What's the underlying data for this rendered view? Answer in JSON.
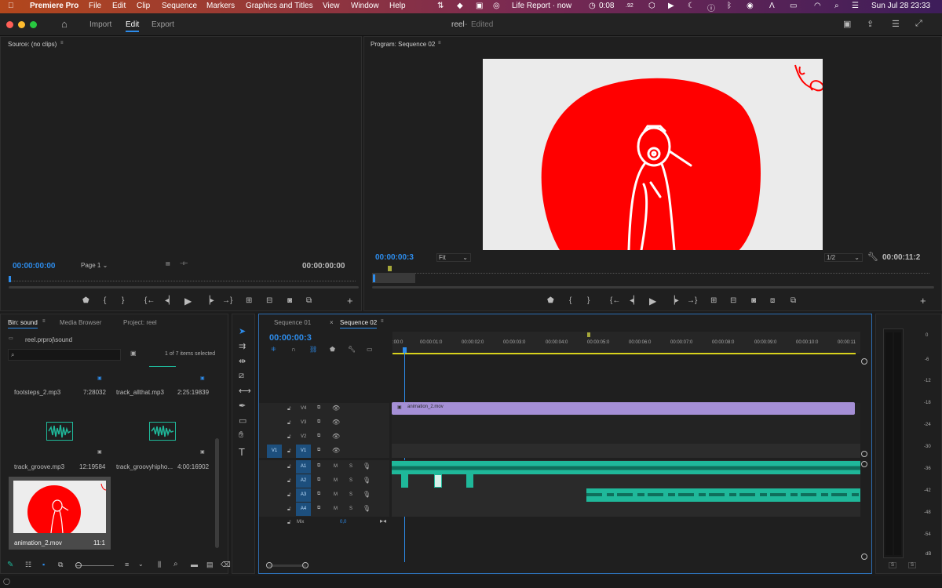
{
  "menubar": {
    "app": "Premiere Pro",
    "items": [
      "File",
      "Edit",
      "Clip",
      "Sequence",
      "Markers",
      "Graphics and Titles",
      "View",
      "Window",
      "Help"
    ],
    "status": {
      "now_playing": "Life Report · now",
      "timer": "0:08",
      "badge": ".92",
      "date": "Sun Jul 28",
      "time": "23:33"
    }
  },
  "header": {
    "tabs": [
      "Import",
      "Edit",
      "Export"
    ],
    "active_tab": "Edit",
    "doc_title": "reel",
    "doc_state": "Edited"
  },
  "source": {
    "title": "Source: (no clips)",
    "timecode_left": "00:00:00:00",
    "page": "Page 1",
    "timecode_right": "00:00:00:00"
  },
  "program": {
    "title": "Program: Sequence 02",
    "timecode": "00:00:00:3",
    "fit": "Fit",
    "quality": "1/2",
    "duration": "00:00:11:2"
  },
  "project": {
    "tabs": [
      "Bin: sound",
      "Media Browser",
      "Project: reel"
    ],
    "path": "reel.prproj\\sound",
    "selection": "1 of 7 items selected",
    "items": [
      {
        "name": "footsteps_2.mp3",
        "duration": "7:28032"
      },
      {
        "name": "track_allthat.mp3",
        "duration": "2:25:19839"
      },
      {
        "name": "track_groove.mp3",
        "duration": "12:19584"
      },
      {
        "name": "track_groovyhipho...",
        "duration": "4:00:16902"
      },
      {
        "name": "animation_2.mov",
        "duration": "11:1"
      }
    ]
  },
  "timeline": {
    "tabs": [
      "Sequence 01",
      "Sequence 02"
    ],
    "active_tab": "Sequence 02",
    "timecode": "00:00:00:3",
    "ruler": [
      ":00:0",
      "00:00:01:0",
      "00:00:02:0",
      "00:00:03:0",
      "00:00:04:0",
      "00:00:05:0",
      "00:00:06:0",
      "00:00:07:0",
      "00:00:08:0",
      "00:00:09:0",
      "00:00:10:0",
      "00:00:11"
    ],
    "video_tracks": [
      "V4",
      "V3",
      "V2",
      "V1"
    ],
    "audio_tracks": [
      "A1",
      "A2",
      "A3",
      "A4"
    ],
    "source_patch_v": "V1",
    "mix_label": "Mix",
    "mix_value": "0,0",
    "clip_video": "animation_2.mov",
    "m_label": "M",
    "s_label": "S"
  },
  "meters": {
    "scale": [
      "0",
      "-6",
      "-12",
      "-18",
      "-24",
      "-30",
      "-36",
      "-42",
      "-48",
      "-54",
      "dB"
    ],
    "solo": [
      "S",
      "S"
    ]
  },
  "colors": {
    "accent": "#2d8ceb",
    "video_clip": "#a58fd6",
    "audio_clip": "#1fb89a",
    "red": "#ff0000"
  }
}
